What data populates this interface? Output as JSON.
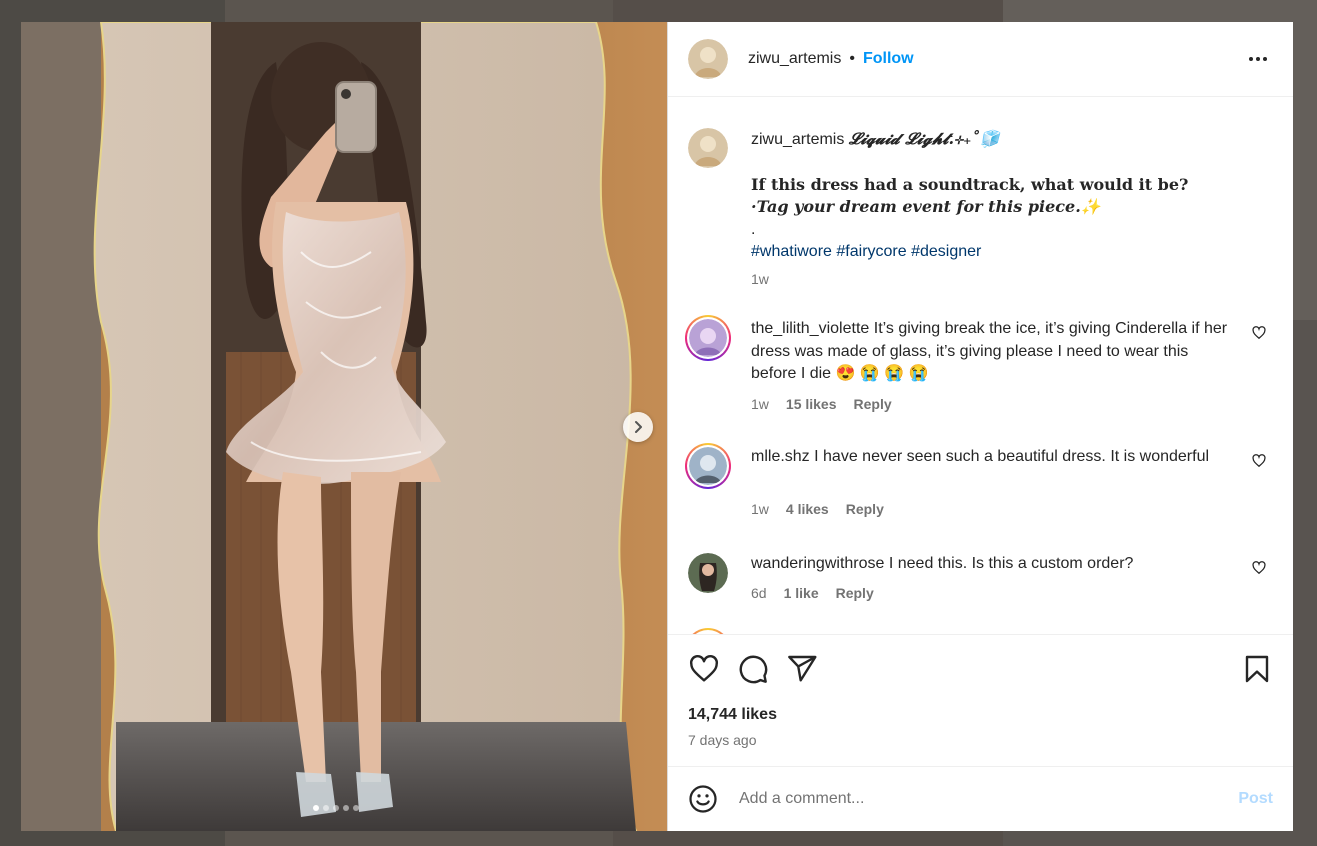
{
  "post": {
    "username": "ziwu_artemis",
    "follow_label": "Follow",
    "separator": "•",
    "caption": {
      "title": "𝓛𝓲𝓺𝓾𝓲𝓭 𝓛𝓲𝓰𝓱𝓽.⊹₊˚🧊",
      "line1": "If this dress had a soundtrack, what would it be?",
      "line2": "·Tag your dream event for this piece.✨",
      "dot": ".",
      "hashtags": [
        "#whatiwore",
        "#fairycore",
        "#designer"
      ],
      "time": "1w"
    },
    "likes_text": "14,744 likes",
    "date_text": "7 days ago",
    "carousel": {
      "total_images": 5,
      "active_index": 0
    }
  },
  "comments": [
    {
      "username": "the_lilith_violette",
      "text": "It’s giving break the ice, it’s giving Cinderella if her dress was made of glass, it’s giving please I need to wear this before I die 😍 😭 😭 😭",
      "time": "1w",
      "likes": "15 likes",
      "reply": "Reply",
      "story_ring": true
    },
    {
      "username": "mlle.shz",
      "text": "I have never seen such a beautiful dress. It is wonderful",
      "time": "1w",
      "likes": "4 likes",
      "reply": "Reply",
      "story_ring": true
    },
    {
      "username": "wanderingwithrose",
      "text": "I need this. Is this a custom order?",
      "time": "6d",
      "likes": "1 like",
      "reply": "Reply",
      "story_ring": false
    }
  ],
  "composer": {
    "placeholder": "Add a comment...",
    "post_label": "Post"
  },
  "icons": {
    "like": "heart-icon",
    "comment": "comment-icon",
    "share": "send-icon",
    "save": "bookmark-icon",
    "emoji": "emoji-icon",
    "more": "more-options-icon",
    "next": "chevron-right-icon"
  },
  "colors": {
    "link_blue": "#0095f6",
    "hashtag": "#00376b",
    "muted": "#737373",
    "post_disabled": "#b3dbff"
  }
}
